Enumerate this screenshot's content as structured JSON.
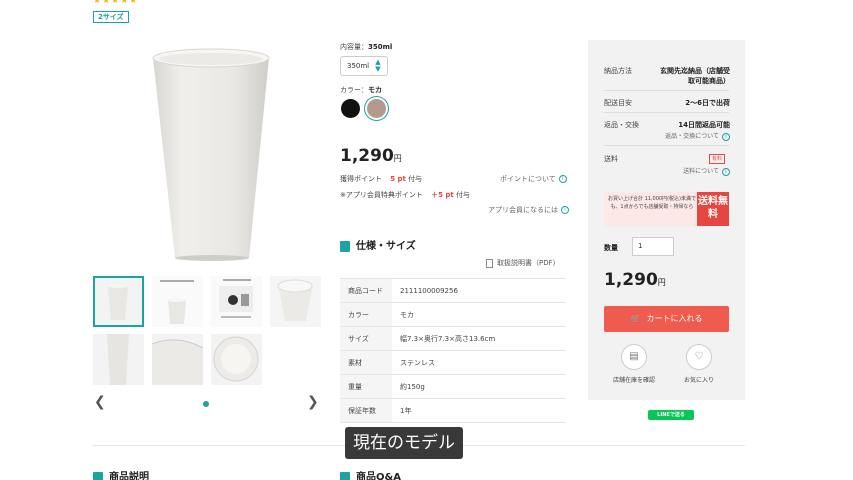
{
  "rating": {
    "stars": "★★★★★"
  },
  "size_badge": "2サイズ",
  "capacity": {
    "label": "内容量：",
    "value": "350ml"
  },
  "size_select": {
    "value": "350ml"
  },
  "color": {
    "label": "カラー：",
    "value": "モカ",
    "swatches": [
      "#111111",
      "#b39a8a"
    ]
  },
  "price": {
    "amount": "1,290",
    "unit": "円"
  },
  "points": {
    "earn_label": "獲得ポイント",
    "earn_value": "5 pt",
    "earn_suffix": "付与",
    "points_link": "ポイントについて",
    "app_label": "※アプリ会員特典ポイント",
    "app_value": "＋5 pt",
    "app_suffix": "付与",
    "app_link": "アプリ会員になるには"
  },
  "spec": {
    "title": "仕様・サイズ",
    "manual": "取扱説明書（PDF）",
    "rows": [
      {
        "k": "商品コード",
        "v": "2111100009256"
      },
      {
        "k": "カラー",
        "v": "モカ"
      },
      {
        "k": "サイズ",
        "v": "幅7.3×奥行7.3×高さ13.6cm"
      },
      {
        "k": "素材",
        "v": "ステンレス"
      },
      {
        "k": "重量",
        "v": "約150g"
      },
      {
        "k": "保証年数",
        "v": "1年"
      }
    ]
  },
  "panel": {
    "delivery_method_label": "納品方法",
    "delivery_method_value": "玄関先迄納品（店舗受取可能商品）",
    "ship_label": "配送目安",
    "ship_value": "2～6日で出荷",
    "return_label": "返品・交換",
    "return_value": "14日間返品可能",
    "return_link": "返品・交換について",
    "fee_label": "送料",
    "fee_tag": "有料",
    "fee_link": "送料について",
    "banner_text": "お買い上げ合計 11,000円(税込)未満でも、1点からでも店舗受取・持帰なら",
    "banner_free": "送料無料",
    "qty_label": "数量",
    "qty_value": "1",
    "price": "1,290",
    "price_unit": "円",
    "cart_button": "カートに入れる",
    "store_stock": "店舗在庫を確認",
    "favorite": "お気に入り",
    "line_button": "LINEで送る"
  },
  "bottom": {
    "desc_title": "商品説明",
    "qa_title": "商品Q&A"
  },
  "caption": "現在のモデル",
  "colors": {
    "accent": "#1aa3a1",
    "red": "#e5463f"
  }
}
